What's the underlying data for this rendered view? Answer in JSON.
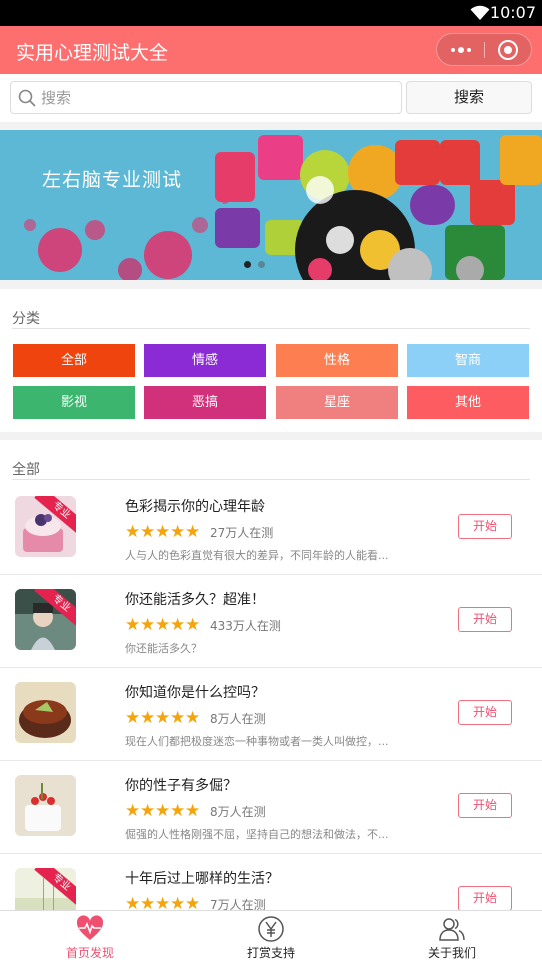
{
  "status_bar": {
    "time": "10:07",
    "wifi_icon": "wifi-icon"
  },
  "nav": {
    "title": "实用心理测试大全",
    "more_icon": "more-dots-icon",
    "close_icon": "close-circle-icon"
  },
  "search": {
    "placeholder": "搜索",
    "button_label": "搜索",
    "icon": "search-icon"
  },
  "banner": {
    "text": "左右脑专业测试",
    "active_dot": 0,
    "dot_count": 2
  },
  "categories": {
    "title": "分类",
    "items": [
      {
        "label": "全部",
        "color": "#f0440f"
      },
      {
        "label": "情感",
        "color": "#8a2bd6"
      },
      {
        "label": "性格",
        "color": "#fd7e50"
      },
      {
        "label": "智商",
        "color": "#8dd0f7"
      },
      {
        "label": "影视",
        "color": "#3cb66f"
      },
      {
        "label": "恶搞",
        "color": "#d1307a"
      },
      {
        "label": "星座",
        "color": "#f08080"
      },
      {
        "label": "其他",
        "color": "#fd5d60"
      }
    ]
  },
  "list": {
    "title": "全部",
    "items": [
      {
        "name": "色彩揭示你的心理年龄",
        "rating": 5,
        "count": "27万人在测",
        "desc": "人与人的色彩直觉有很大的差异，不同年龄的人能看...",
        "button": "开始",
        "badge": "专业"
      },
      {
        "name": "你还能活多久？超准！",
        "rating": 5,
        "count": "433万人在测",
        "desc": "你还能活多久？",
        "button": "开始",
        "badge": "专业"
      },
      {
        "name": "你知道你是什么控吗？",
        "rating": 5,
        "count": "8万人在测",
        "desc": "现在人们都把极度迷恋一种事物或者一类人叫做控，...",
        "button": "开始",
        "badge": ""
      },
      {
        "name": "你的性子有多倔？",
        "rating": 5,
        "count": "8万人在测",
        "desc": "倔强的人性格刚强不屈，坚持自己的想法和做法，不...",
        "button": "开始",
        "badge": ""
      },
      {
        "name": "十年后过上哪样的生活？",
        "rating": 5,
        "count": "7万人在测",
        "desc": "",
        "button": "开始",
        "badge": "专业"
      }
    ]
  },
  "tabs": [
    {
      "label": "首页发现",
      "icon": "heartbeat-icon",
      "active": true
    },
    {
      "label": "打赏支持",
      "icon": "yen-icon",
      "active": false
    },
    {
      "label": "关于我们",
      "icon": "users-icon",
      "active": false
    }
  ],
  "colors": {
    "accent": "#fd6f6f",
    "star": "#f5a40b",
    "button_border": "#f07080"
  }
}
